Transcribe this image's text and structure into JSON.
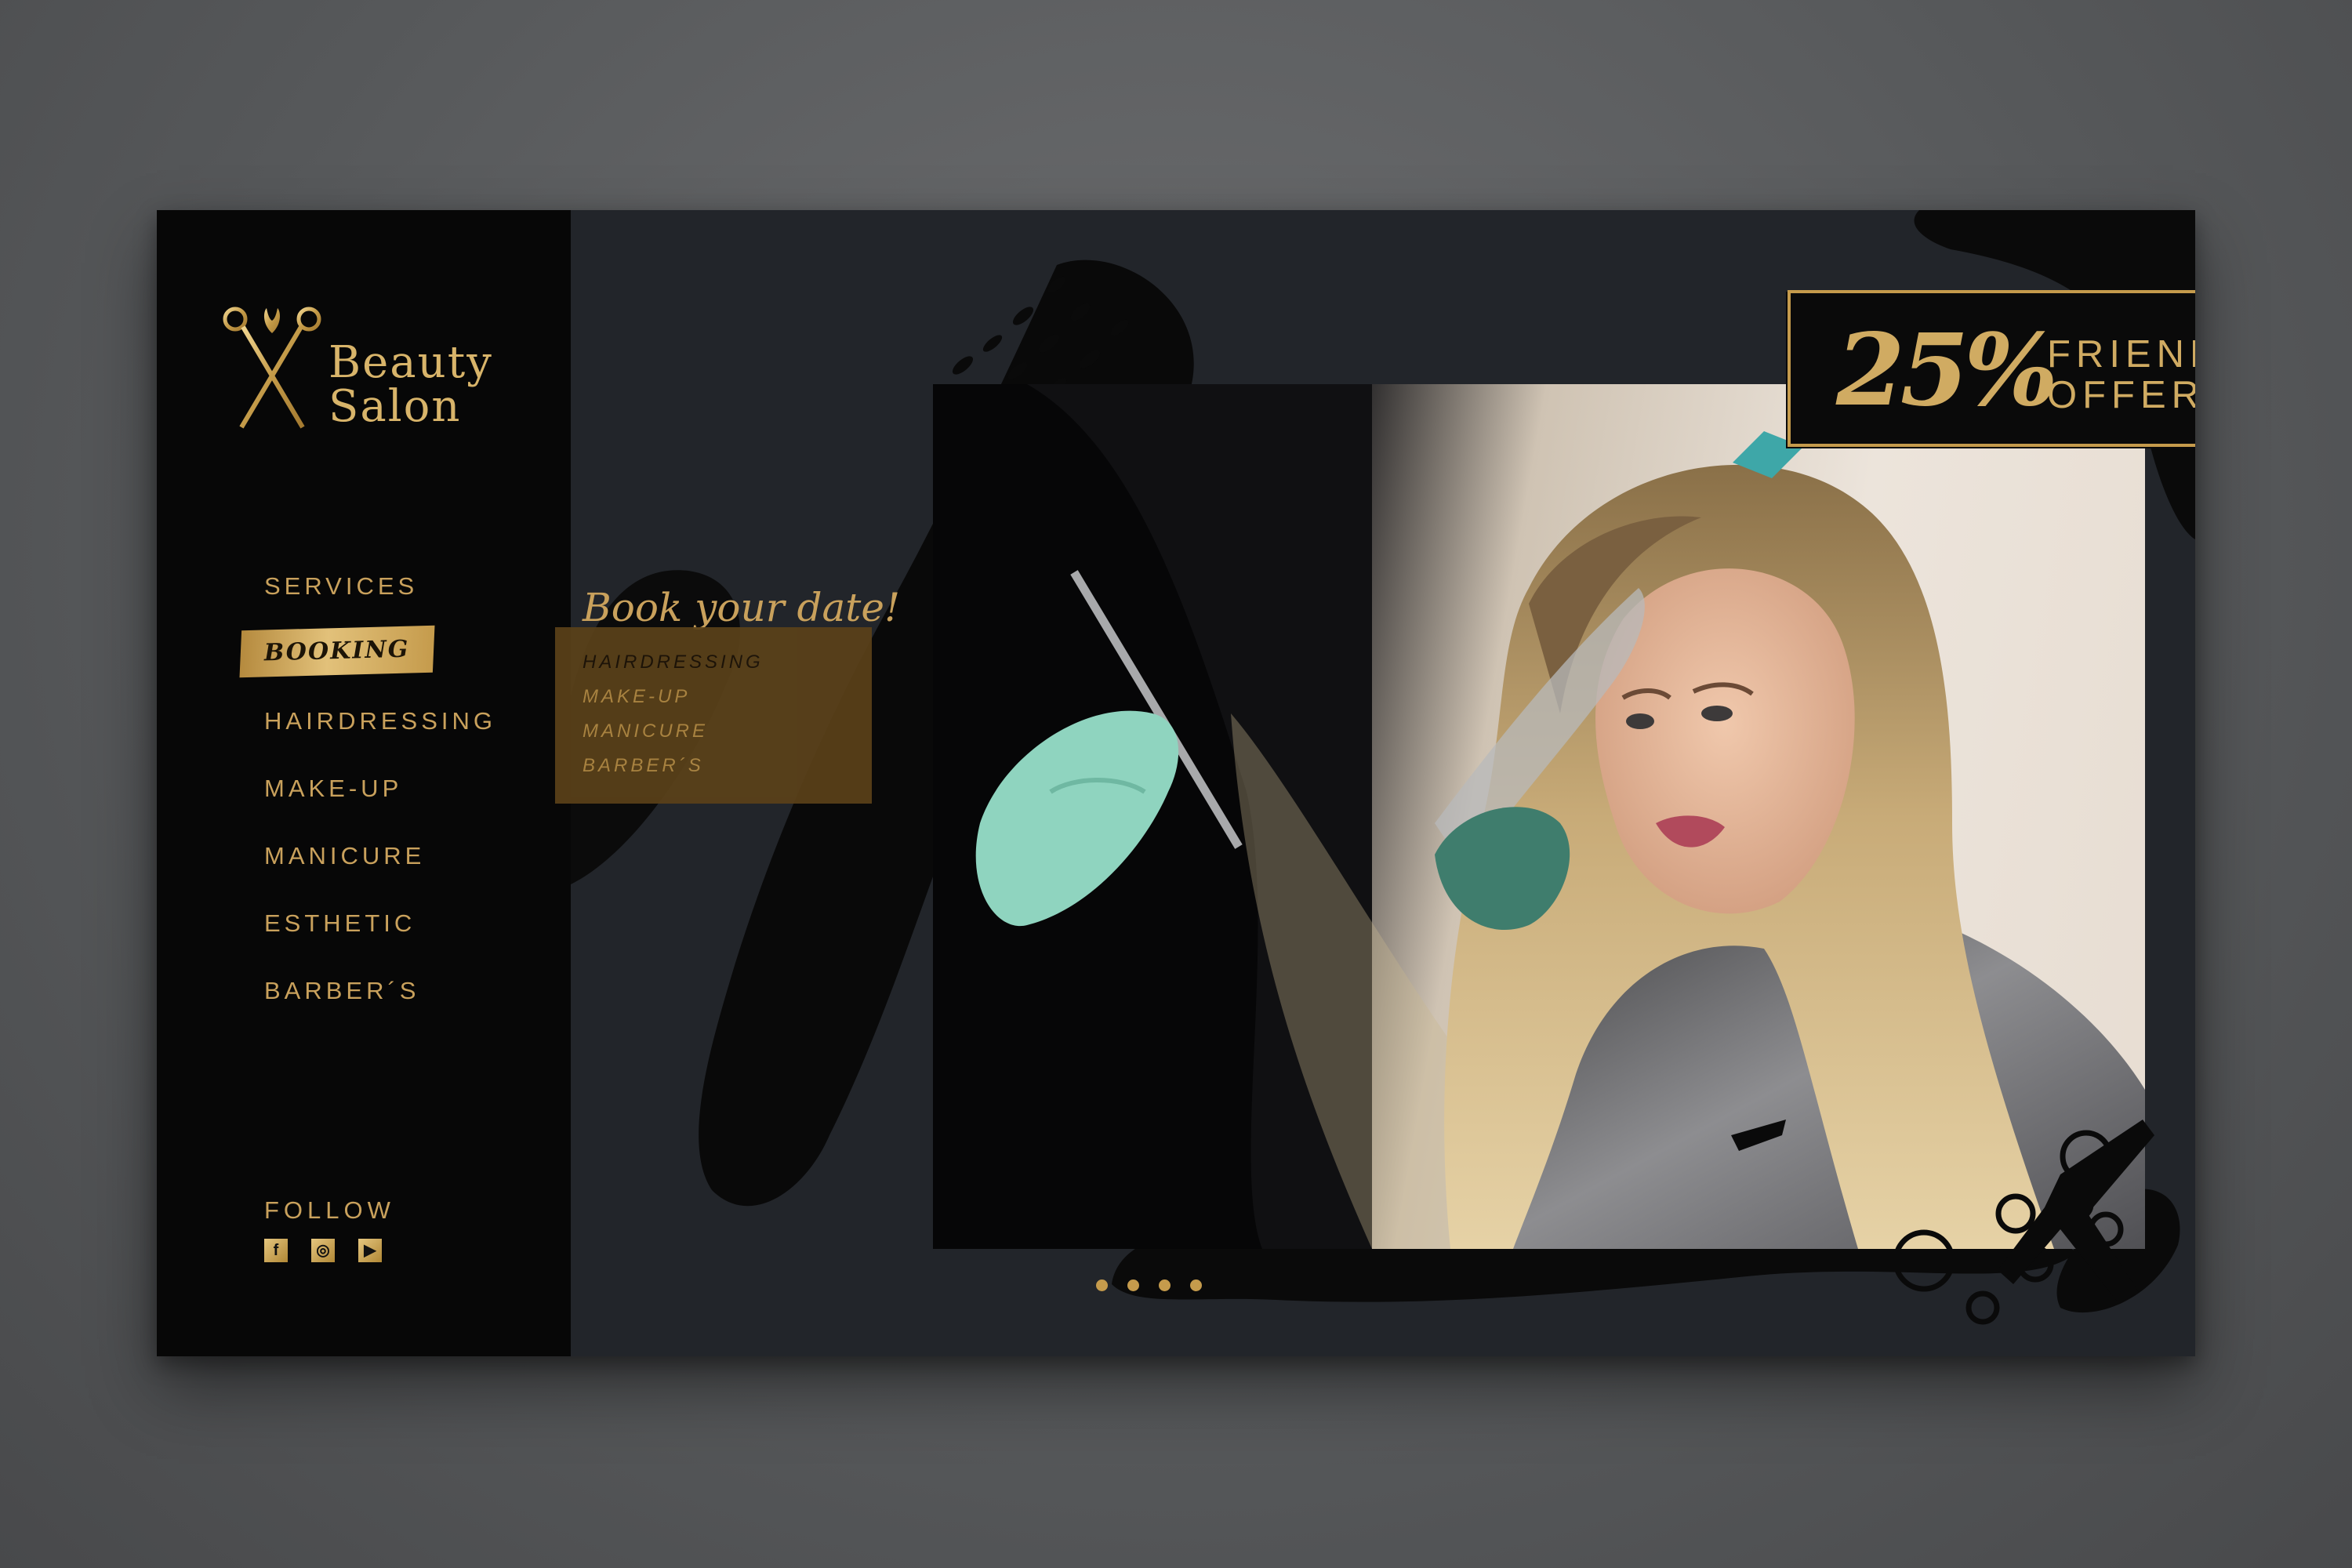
{
  "brand": {
    "name_line1": "Beauty",
    "name_line2": "Salon",
    "logo_icon": "scissors-tulip-icon"
  },
  "nav": {
    "items": [
      {
        "label": "SERVICES",
        "active": false
      },
      {
        "label": "BOOKING",
        "active": true
      },
      {
        "label": "HAIRDRESSING",
        "active": false
      },
      {
        "label": "MAKE-UP",
        "active": false
      },
      {
        "label": "MANICURE",
        "active": false
      },
      {
        "label": "ESTHETIC",
        "active": false
      },
      {
        "label": "BARBER´S",
        "active": false
      }
    ]
  },
  "social": {
    "label": "FOLLOW",
    "icons": [
      {
        "name": "facebook-icon",
        "glyph": "f"
      },
      {
        "name": "instagram-icon",
        "glyph": "◎"
      },
      {
        "name": "youtube-icon",
        "glyph": "▶"
      }
    ]
  },
  "booking": {
    "title": "Book your date!",
    "items": [
      "HAIRDRESSING",
      "MAKE-UP",
      "MANICURE",
      "BARBER´S"
    ]
  },
  "offer": {
    "percent": "25%",
    "line1": "FRIEND",
    "line2": "OFFER!"
  },
  "carousel": {
    "slide_count": 4,
    "active_index": 0
  },
  "colors": {
    "gold": "#c9a15c",
    "gold_light": "#e2c17a",
    "panel_dark": "#22252a",
    "sidebar_black": "#070707",
    "booking_box": "#5a4119",
    "glove_mint": "#8fd4bf"
  }
}
